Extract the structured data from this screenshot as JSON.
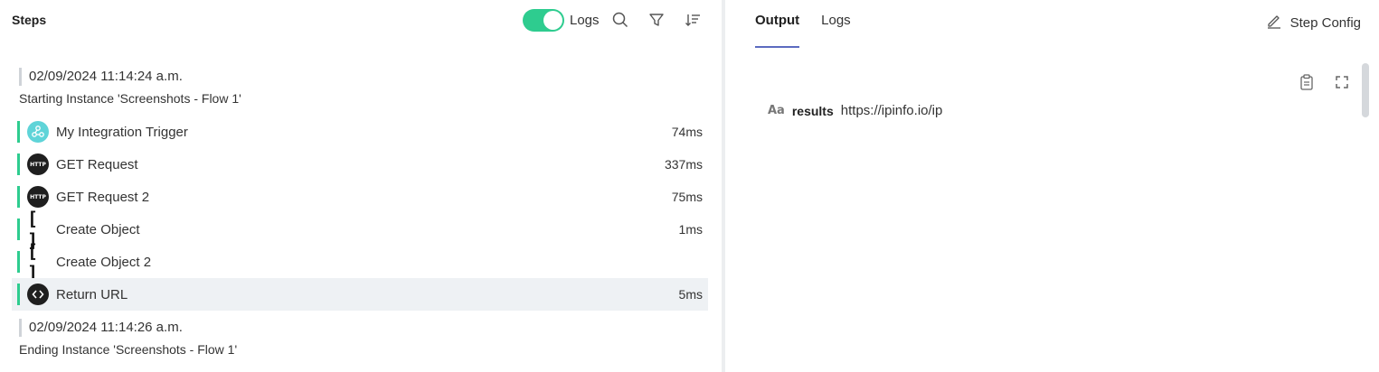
{
  "left": {
    "title": "Steps",
    "logs_toggle": {
      "label": "Logs",
      "on": true
    },
    "start": {
      "timestamp": "02/09/2024 11:14:24 a.m.",
      "message": "Starting Instance 'Screenshots - Flow 1'"
    },
    "end": {
      "timestamp": "02/09/2024 11:14:26 a.m.",
      "message": "Ending Instance 'Screenshots - Flow 1'"
    },
    "steps": [
      {
        "name": "My Integration Trigger",
        "duration": "74ms",
        "icon": "trigger-icon"
      },
      {
        "name": "GET Request",
        "duration": "337ms",
        "icon": "http-icon",
        "icon_text": "HTTP"
      },
      {
        "name": "GET Request 2",
        "duration": "75ms",
        "icon": "http-icon",
        "icon_text": "HTTP"
      },
      {
        "name": "Create Object",
        "duration": "1ms",
        "icon": "brackets-icon",
        "icon_text": "[ ]"
      },
      {
        "name": "Create Object 2",
        "duration": "",
        "icon": "brackets-icon",
        "icon_text": "[ ]"
      },
      {
        "name": "Return URL",
        "duration": "5ms",
        "icon": "code-icon",
        "selected": true
      }
    ]
  },
  "right": {
    "tabs": [
      {
        "label": "Output",
        "active": true
      },
      {
        "label": "Logs",
        "active": false
      }
    ],
    "step_config_label": "Step Config",
    "result": {
      "type_icon": "Aa",
      "key": "results",
      "value": "https://ipinfo.io/ip"
    }
  },
  "colors": {
    "accent_green": "#2ecc8f",
    "tab_underline": "#5c6bc0",
    "selected_row": "#eef1f4"
  }
}
